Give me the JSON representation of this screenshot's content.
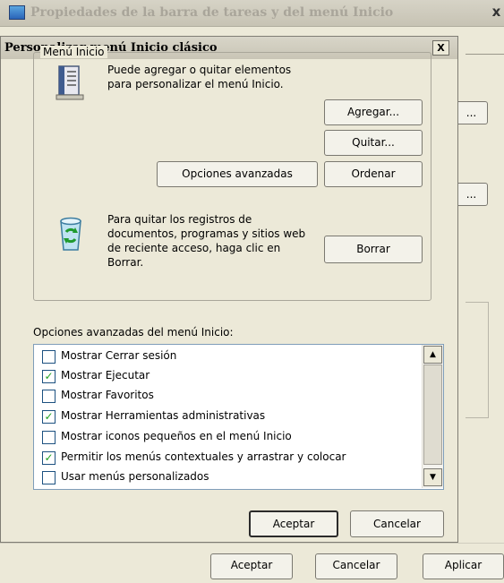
{
  "parent_window": {
    "title": "Propiedades de la barra de tareas y del menú Inicio",
    "close_label": "x",
    "side_button_label": "...",
    "accept_label": "Aceptar",
    "cancel_label": "Cancelar",
    "apply_label": "Aplicar"
  },
  "dialog": {
    "title": "Personalizar menú Inicio clásico",
    "close_label": "X",
    "group_label": "Menú Inicio",
    "add_remove_text": "Puede agregar o quitar elementos para personalizar el menú Inicio.",
    "clear_text": "Para quitar los registros de documentos, programas y sitios web de reciente acceso, haga clic en Borrar.",
    "buttons": {
      "agregar": "Agregar...",
      "quitar": "Quitar...",
      "avanzadas": "Opciones avanzadas",
      "ordenar": "Ordenar",
      "borrar": "Borrar",
      "aceptar": "Aceptar",
      "cancelar": "Cancelar"
    },
    "advanced_label": "Opciones avanzadas del menú Inicio:",
    "options": [
      {
        "label": "Mostrar Cerrar sesión",
        "checked": false
      },
      {
        "label": "Mostrar Ejecutar",
        "checked": true
      },
      {
        "label": "Mostrar Favoritos",
        "checked": false
      },
      {
        "label": "Mostrar Herramientas administrativas",
        "checked": true
      },
      {
        "label": "Mostrar iconos pequeños en el menú Inicio",
        "checked": false
      },
      {
        "label": "Permitir los menús contextuales y arrastrar y colocar",
        "checked": true
      },
      {
        "label": "Usar menús personalizados",
        "checked": false
      }
    ],
    "check_mark": "✓",
    "scroll_up": "▲",
    "scroll_down": "▼"
  }
}
